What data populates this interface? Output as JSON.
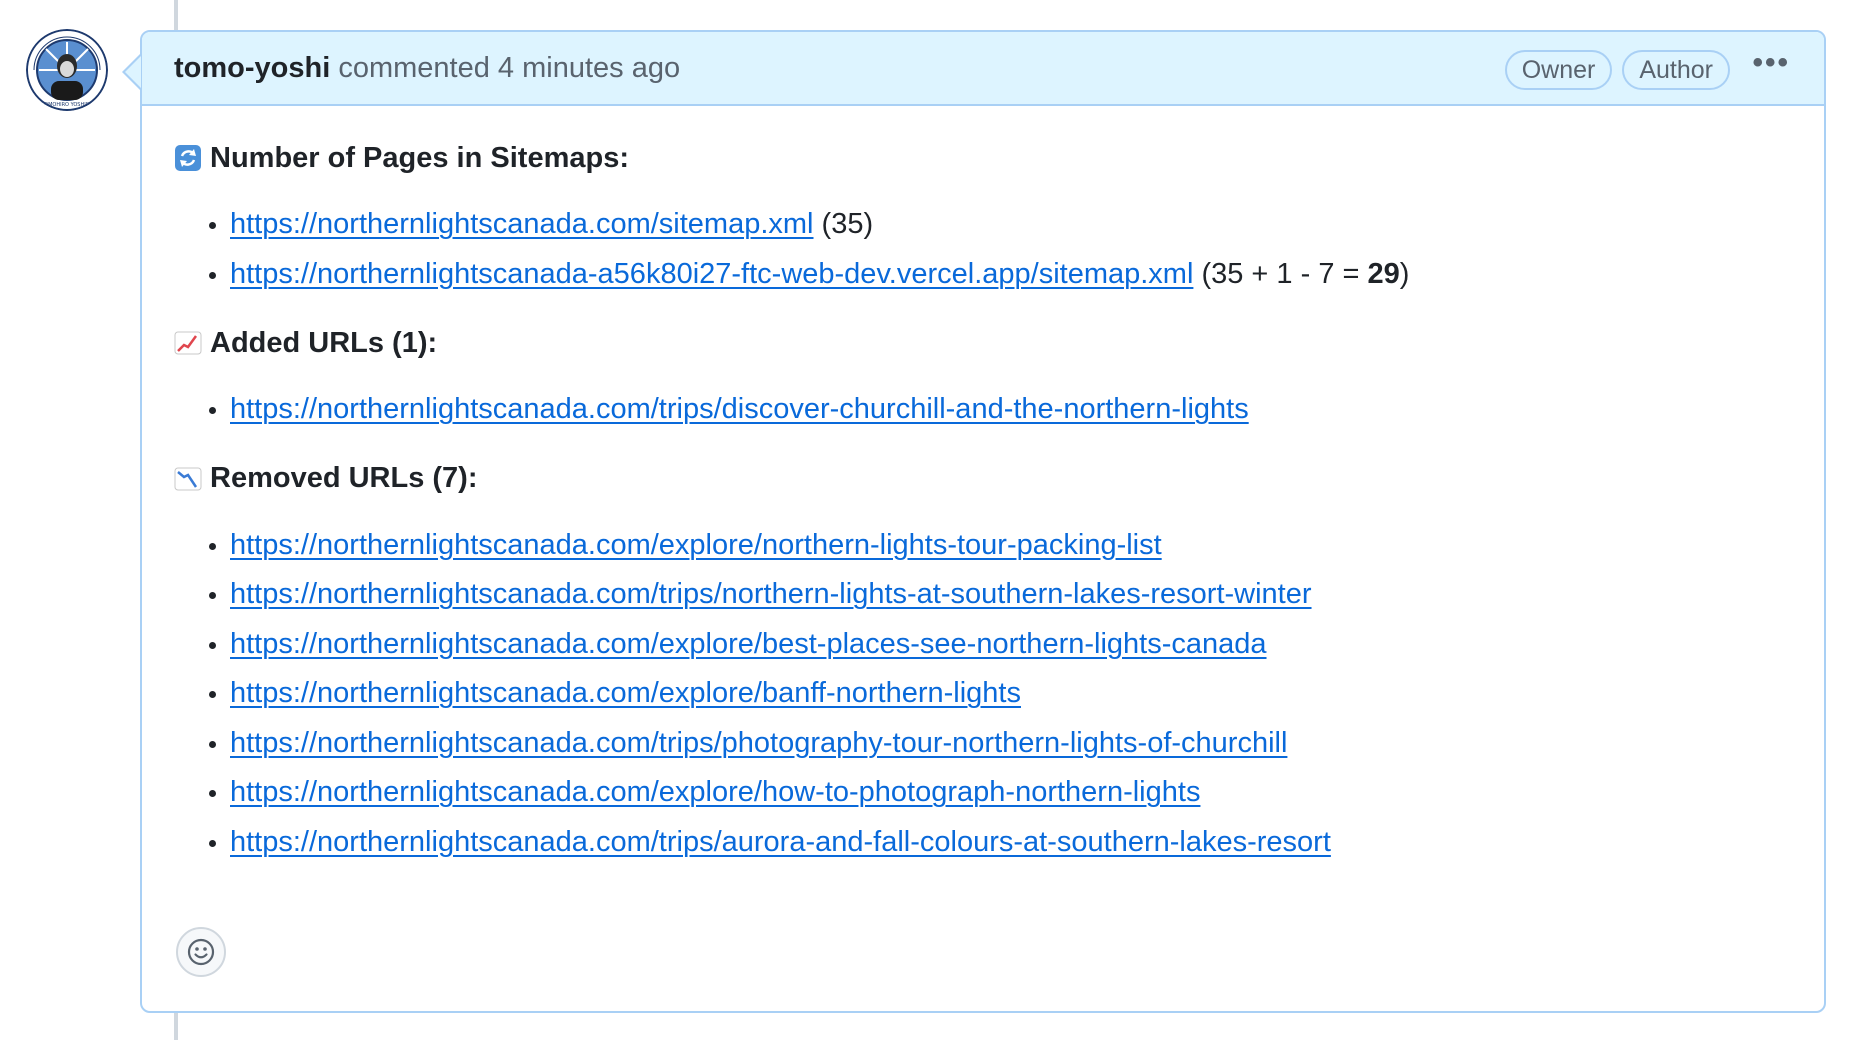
{
  "comment": {
    "author": "tomo-yoshi",
    "action": "commented",
    "time": "4 minutes ago",
    "badges": [
      "Owner",
      "Author"
    ],
    "more_label": "•••"
  },
  "sections": {
    "pages": {
      "emoji": "arrows-counterclockwise-icon",
      "heading": "Number of Pages in Sitemaps:",
      "items": [
        {
          "url": "https://northernlightscanada.com/sitemap.xml",
          "suffix": " (35)"
        },
        {
          "url": "https://northernlightscanada-a56k80i27-ftc-web-dev.vercel.app/sitemap.xml",
          "suffix_pre": " (35 + 1 - 7 = ",
          "suffix_bold": "29",
          "suffix_post": ")"
        }
      ]
    },
    "added": {
      "emoji": "chart-increasing-icon",
      "heading": "Added URLs (1):",
      "items": [
        "https://northernlightscanada.com/trips/discover-churchill-and-the-northern-lights"
      ]
    },
    "removed": {
      "emoji": "chart-decreasing-icon",
      "heading": "Removed URLs (7):",
      "items": [
        "https://northernlightscanada.com/explore/northern-lights-tour-packing-list",
        "https://northernlightscanada.com/trips/northern-lights-at-southern-lakes-resort-winter",
        "https://northernlightscanada.com/explore/best-places-see-northern-lights-canada",
        "https://northernlightscanada.com/explore/banff-northern-lights",
        "https://northernlightscanada.com/trips/photography-tour-northern-lights-of-churchill",
        "https://northernlightscanada.com/explore/how-to-photograph-northern-lights",
        "https://northernlightscanada.com/trips/aurora-and-fall-colours-at-southern-lakes-resort"
      ]
    }
  },
  "avatar_text": "TOMOHIRO YOSHIDA",
  "colors": {
    "link": "#0969da",
    "header_bg": "#ddf4ff",
    "border": "#a9d0f5"
  }
}
